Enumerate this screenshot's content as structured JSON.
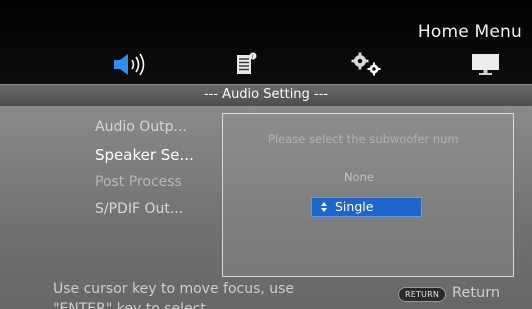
{
  "header": {
    "title": "Home Menu",
    "icons": [
      "speaker-icon",
      "document-icon",
      "gears-icon",
      "monitor-icon"
    ]
  },
  "section": {
    "title": "--- Audio Setting ---"
  },
  "menu": {
    "items": [
      {
        "label": "Audio Outp...",
        "state": "normal"
      },
      {
        "label": "Speaker Se...",
        "state": "selected"
      },
      {
        "label": "Post Process",
        "state": "disabled"
      },
      {
        "label": "S/PDIF Out...",
        "state": "normal"
      }
    ]
  },
  "dialog": {
    "prompt": "Please select the subwoofer num",
    "options": [
      "None",
      "Single"
    ],
    "selected_option": "Single"
  },
  "footer": {
    "help_text": "Use cursor key to move focus, use \"ENTER\" key to select.",
    "return_button": "RETURN",
    "return_label": "Return"
  },
  "colors": {
    "accent": "#1e66cc",
    "audio_icon": "#2f8ef5"
  }
}
